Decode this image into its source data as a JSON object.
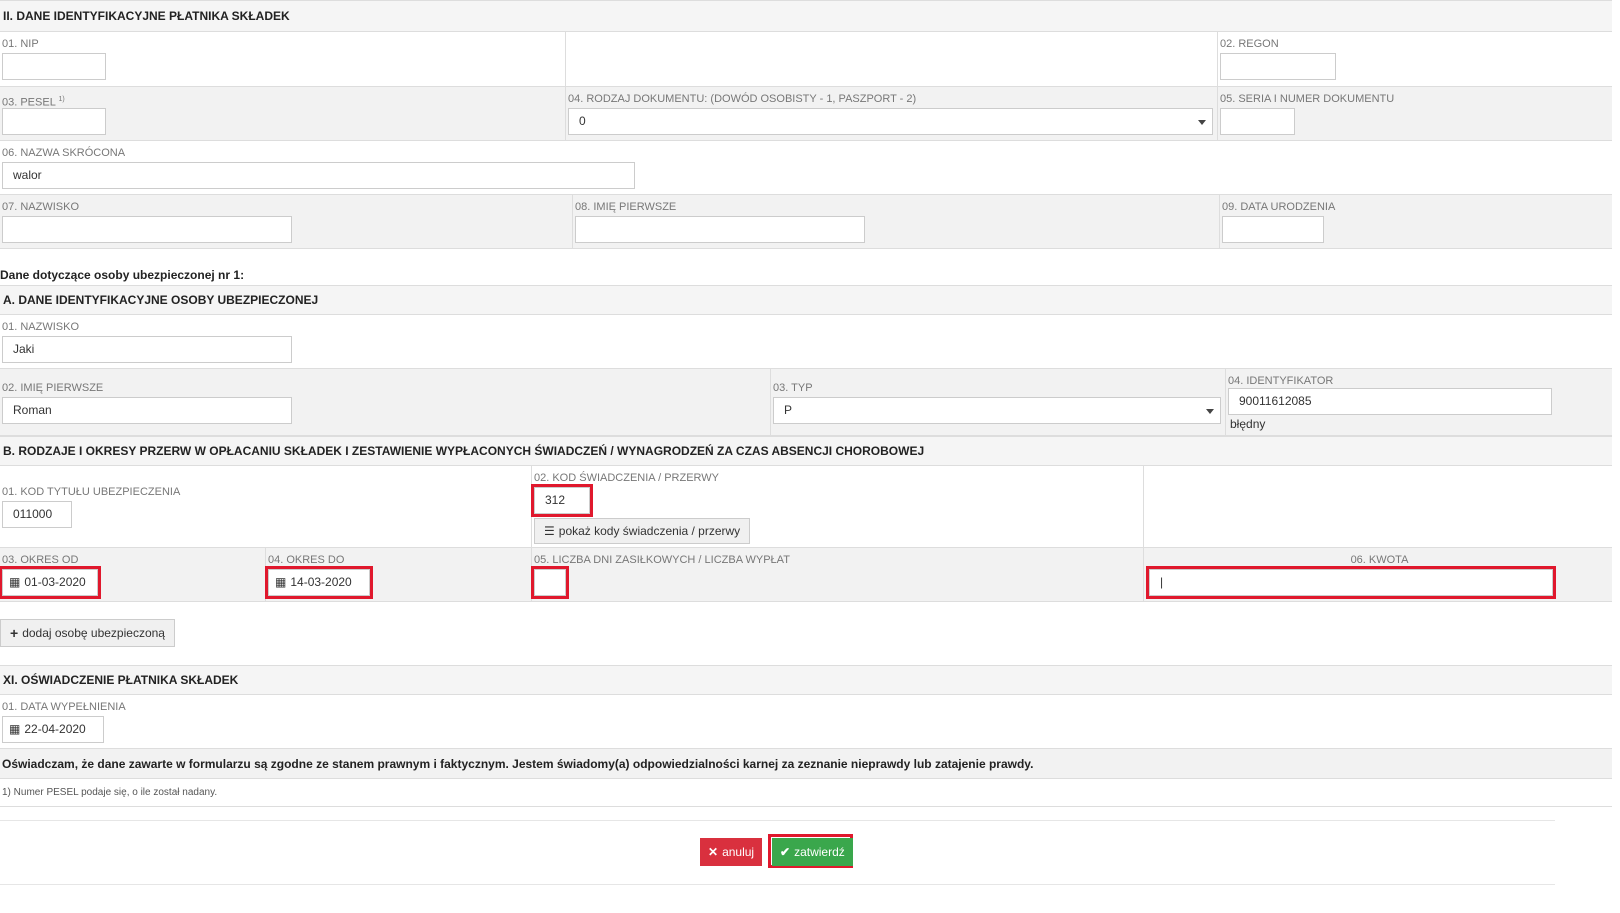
{
  "section2": {
    "title": "II. DANE IDENTYFIKACYJNE PŁATNIKA SKŁADEK",
    "nip_label": "01. NIP",
    "nip_value": "",
    "regon_label": "02. REGON",
    "regon_value": "",
    "pesel_label": "03. PESEL",
    "pesel_sup": "1)",
    "pesel_value": "",
    "doc_type_label": "04. RODZAJ DOKUMENTU: (DOWÓD OSOBISTY - 1, PASZPORT - 2)",
    "doc_type_value": "0",
    "doc_number_label": "05. SERIA I NUMER DOKUMENTU",
    "doc_number_value": "",
    "short_name_label": "06. NAZWA SKRÓCONA",
    "short_name_value": "walor",
    "surname_label": "07. NAZWISKO",
    "surname_value": "",
    "first_name_label": "08. IMIĘ PIERWSZE",
    "first_name_value": "",
    "birth_label": "09. DATA URODZENIA",
    "birth_value": ""
  },
  "insured_heading": "Dane dotyczące osoby ubezpieczonej nr 1:",
  "sectionA": {
    "title": "A. DANE IDENTYFIKACYJNE OSOBY UBEZPIECZONEJ",
    "surname_label": "01. NAZWISKO",
    "surname_value": "Jaki",
    "first_name_label": "02. IMIĘ PIERWSZE",
    "first_name_value": "Roman",
    "type_label": "03. TYP",
    "type_value": "P",
    "id_label": "04. IDENTYFIKATOR",
    "id_value": "90011612085",
    "id_error": "błędny"
  },
  "sectionB": {
    "title": "B. RODZAJE I OKRESY PRZERW W OPŁACANIU SKŁADEK I ZESTAWIENIE WYPŁACONYCH ŚWIADCZEŃ / WYNAGRODZEŃ ZA CZAS ABSENCJI CHOROBOWEJ",
    "title_code_label": "01. KOD TYTUŁU UBEZPIECZENIA",
    "title_code_value": "011000",
    "benefit_code_label": "02. KOD ŚWIADCZENIA / PRZERWY",
    "benefit_code_value": "312",
    "show_codes_label": "pokaż kody świadczenia / przerwy",
    "from_label": "03. OKRES OD",
    "from_value": "01-03-2020",
    "to_label": "04. OKRES DO",
    "to_value": "14-03-2020",
    "days_label": "05. LICZBA DNI ZASIŁKOWYCH / LICZBA WYPŁAT",
    "days_value": "",
    "amount_label": "06. KWOTA",
    "amount_value": "|"
  },
  "add_person_label": "dodaj osobę ubezpieczoną",
  "sectionXI": {
    "title": "XI. OŚWIADCZENIE PŁATNIKA SKŁADEK",
    "fill_date_label": "01. DATA WYPEŁNIENIA",
    "fill_date_value": "22-04-2020",
    "statement": "Oświadczam, że dane zawarte w formularzu są zgodne ze stanem prawnym i faktycznym. Jestem świadomy(a) odpowiedzialności karnej za zeznanie nieprawdy lub zatajenie prawdy.",
    "footnote": "1) Numer PESEL podaje się, o ile został nadany."
  },
  "buttons": {
    "cancel": "anuluj",
    "confirm": "zatwierdź"
  },
  "colors": {
    "highlight": "#e0182d",
    "cancel": "#d9303e",
    "confirm": "#3aa74c"
  }
}
